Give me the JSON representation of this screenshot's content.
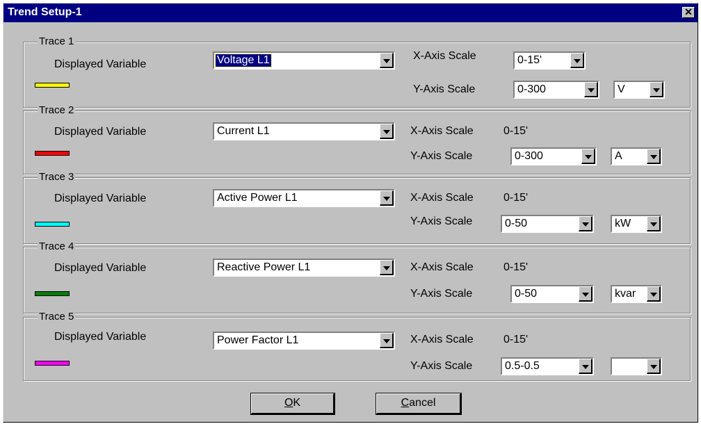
{
  "window": {
    "title": "Trend Setup-1",
    "close_glyph": "✕"
  },
  "labels": {
    "displayed_variable": "Displayed Variable",
    "x_axis_scale": "X-Axis Scale",
    "y_axis_scale": "Y-Axis Scale"
  },
  "traces": [
    {
      "legend": "Trace 1",
      "variable": "Voltage L1",
      "variable_selected": true,
      "x_scale": "0-15'",
      "x_scale_is_dropdown": true,
      "y_scale": "0-300",
      "unit": "V",
      "color": "#ffff00"
    },
    {
      "legend": "Trace 2",
      "variable": "Current L1",
      "variable_selected": false,
      "x_scale": "0-15'",
      "x_scale_is_dropdown": false,
      "y_scale": "0-300",
      "unit": "A",
      "color": "#ff0000"
    },
    {
      "legend": "Trace 3",
      "variable": "Active Power L1",
      "variable_selected": false,
      "x_scale": "0-15'",
      "x_scale_is_dropdown": false,
      "y_scale": "0-50",
      "unit": "kW",
      "color": "#00ffff"
    },
    {
      "legend": "Trace 4",
      "variable": "Reactive Power L1",
      "variable_selected": false,
      "x_scale": "0-15'",
      "x_scale_is_dropdown": false,
      "y_scale": "0-50",
      "unit": "kvar",
      "color": "#008000"
    },
    {
      "legend": "Trace 5",
      "variable": "Power Factor L1",
      "variable_selected": false,
      "x_scale": "0-15'",
      "x_scale_is_dropdown": false,
      "y_scale": "0.5-0.5",
      "unit": "",
      "color": "#ff00ff"
    }
  ],
  "buttons": {
    "ok": {
      "mnemonic": "O",
      "rest": "K"
    },
    "cancel": {
      "mnemonic": "C",
      "rest": "ancel"
    }
  },
  "colors": {
    "title_bar": "#000080",
    "dialog_face": "#c0c0c0"
  }
}
